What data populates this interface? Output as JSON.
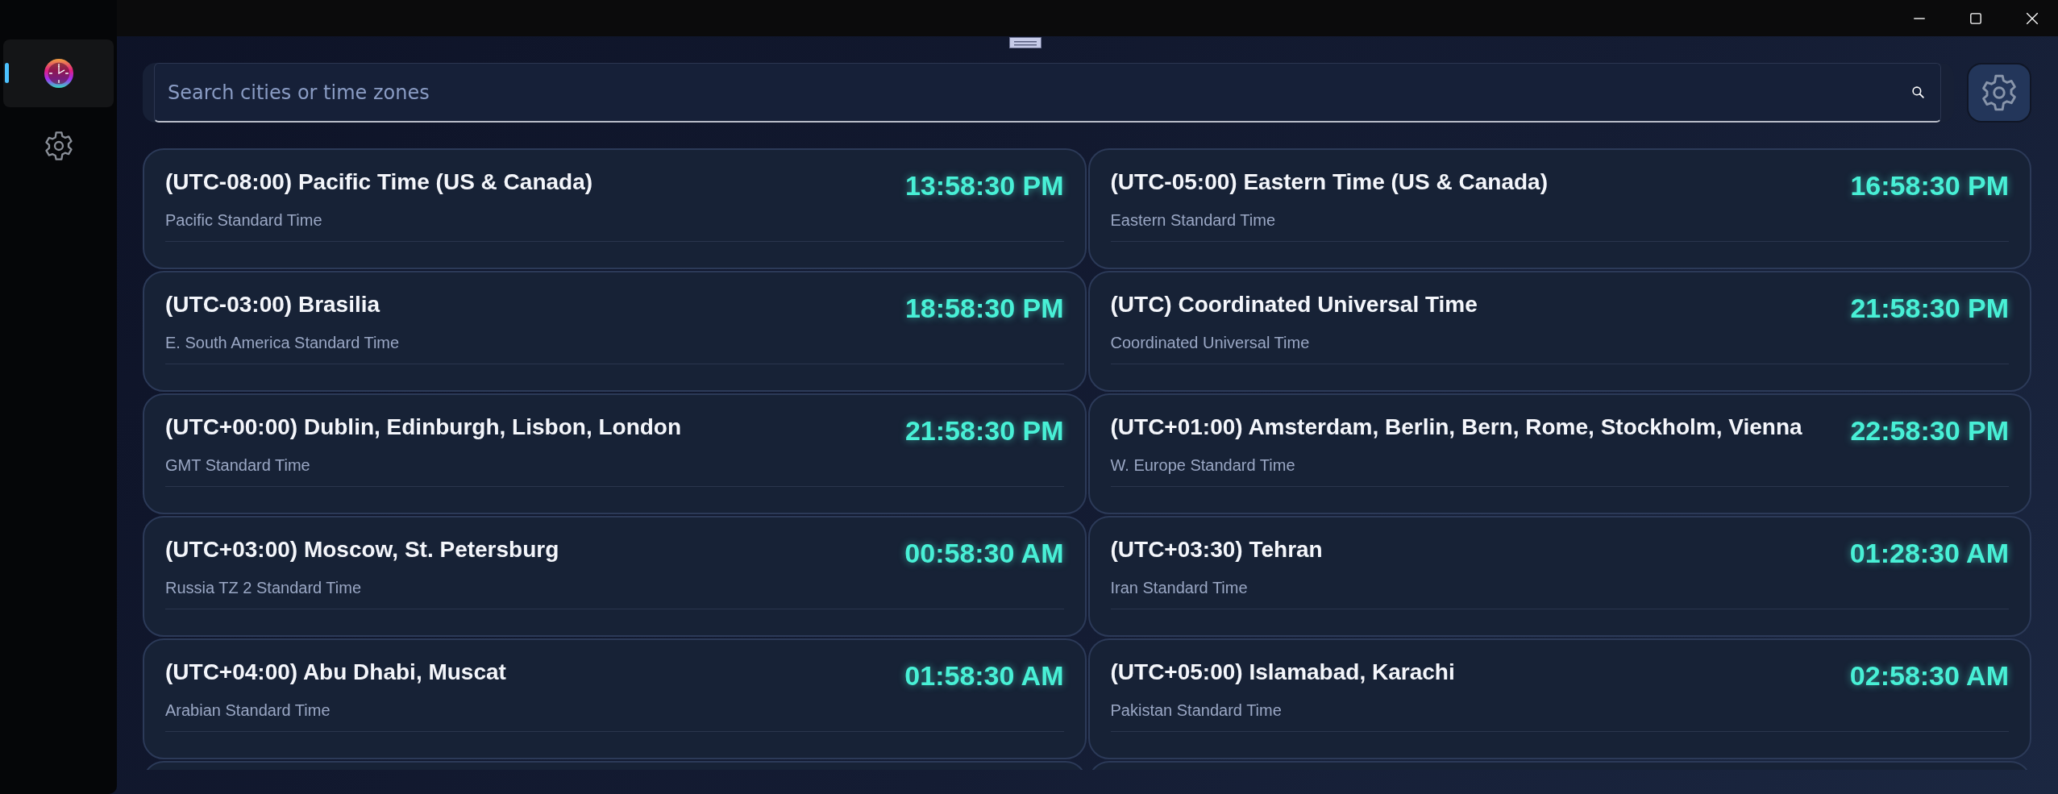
{
  "sidebar": {
    "items": [
      {
        "kind": "clock",
        "selected": true
      },
      {
        "kind": "settings",
        "selected": false
      }
    ]
  },
  "search": {
    "placeholder": "Search cities or time zones"
  },
  "zones": [
    {
      "title": "(UTC-08:00) Pacific Time (US & Canada)",
      "subtitle": "Pacific Standard Time",
      "time": "13:58:30 PM"
    },
    {
      "title": "(UTC-05:00) Eastern Time (US & Canada)",
      "subtitle": "Eastern Standard Time",
      "time": "16:58:30 PM"
    },
    {
      "title": "(UTC-03:00) Brasilia",
      "subtitle": "E. South America Standard Time",
      "time": "18:58:30 PM"
    },
    {
      "title": "(UTC) Coordinated Universal Time",
      "subtitle": "Coordinated Universal Time",
      "time": "21:58:30 PM"
    },
    {
      "title": "(UTC+00:00) Dublin, Edinburgh, Lisbon, London",
      "subtitle": "GMT Standard Time",
      "time": "21:58:30 PM"
    },
    {
      "title": "(UTC+01:00) Amsterdam, Berlin, Bern, Rome, Stockholm, Vienna",
      "subtitle": "W. Europe Standard Time",
      "time": "22:58:30 PM"
    },
    {
      "title": "(UTC+03:00) Moscow, St. Petersburg",
      "subtitle": "Russia TZ 2 Standard Time",
      "time": "00:58:30 AM"
    },
    {
      "title": "(UTC+03:30) Tehran",
      "subtitle": "Iran Standard Time",
      "time": "01:28:30 AM"
    },
    {
      "title": "(UTC+04:00) Abu Dhabi, Muscat",
      "subtitle": "Arabian Standard Time",
      "time": "01:58:30 AM"
    },
    {
      "title": "(UTC+05:00) Islamabad, Karachi",
      "subtitle": "Pakistan Standard Time",
      "time": "02:58:30 AM"
    }
  ]
}
